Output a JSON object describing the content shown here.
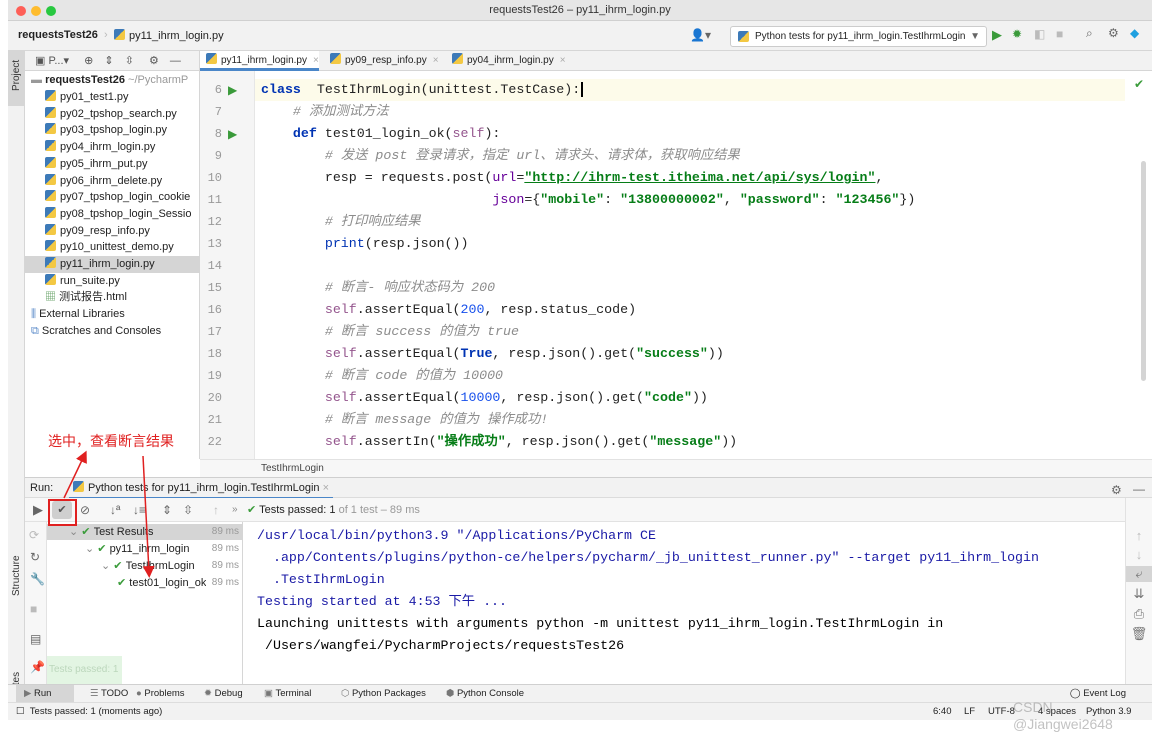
{
  "window": {
    "title": "requestsTest26 – py11_ihrm_login.py"
  },
  "nav": {
    "project": "requestsTest26",
    "file": "py11_ihrm_login.py",
    "run_config": "Python tests for py11_ihrm_login.TestIhrmLogin"
  },
  "sidebar": {
    "project_label": "Project",
    "structure_label": "Structure",
    "favorites_label": "Favorites",
    "panel_dropdown": "P...",
    "root": {
      "name": "requestsTest26",
      "path": "~/PycharmP"
    },
    "files": [
      "py01_test1.py",
      "py02_tpshop_search.py",
      "py03_tpshop_login.py",
      "py04_ihrm_login.py",
      "py05_ihrm_put.py",
      "py06_ihrm_delete.py",
      "py07_tpshop_login_cookie",
      "py08_tpshop_login_Sessio",
      "py09_resp_info.py",
      "py10_unittest_demo.py",
      "py11_ihrm_login.py",
      "run_suite.py",
      "测试报告.html"
    ],
    "selected_file": "py11_ihrm_login.py",
    "extras": [
      "External Libraries",
      "Scratches and Consoles"
    ]
  },
  "editor": {
    "tabs": [
      "py11_ihrm_login.py",
      "py09_resp_info.py",
      "py04_ihrm_login.py"
    ],
    "active_tab": 0,
    "lines": [
      {
        "n": "6",
        "run": true,
        "t": [
          [
            "kw",
            "class"
          ],
          [
            "",
            "  TestIhrmLogin(unittest.TestCase):"
          ]
        ]
      },
      {
        "n": "7",
        "t": [
          [
            "",
            "    "
          ],
          [
            "cm",
            "# 添加测试方法"
          ]
        ]
      },
      {
        "n": "8",
        "run": true,
        "t": [
          [
            "",
            "    "
          ],
          [
            "kw",
            "def"
          ],
          [
            "",
            " test01_login_ok("
          ],
          [
            "sf",
            "self"
          ],
          [
            "",
            "):"
          ]
        ]
      },
      {
        "n": "9",
        "t": [
          [
            "",
            "        "
          ],
          [
            "cm",
            "# 发送 post 登录请求，指定 url、请求头、请求体，获取响应结果"
          ]
        ]
      },
      {
        "n": "10",
        "t": [
          [
            "",
            "        resp = requests.post("
          ],
          [
            "pa",
            "url"
          ],
          [
            "",
            "="
          ],
          [
            "url",
            "\"http://ihrm-test.itheima.net/api/sys/login\""
          ],
          [
            "",
            ","
          ]
        ]
      },
      {
        "n": "11",
        "t": [
          [
            "",
            "                             "
          ],
          [
            "pa",
            "json"
          ],
          [
            "",
            "={"
          ],
          [
            "st",
            "\"mobile\""
          ],
          [
            "",
            ": "
          ],
          [
            "st",
            "\"13800000002\""
          ],
          [
            "",
            ", "
          ],
          [
            "st",
            "\"password\""
          ],
          [
            "",
            ": "
          ],
          [
            "st",
            "\"123456\""
          ],
          [
            "",
            "})"
          ]
        ]
      },
      {
        "n": "12",
        "t": [
          [
            "",
            "        "
          ],
          [
            "cm",
            "# 打印响应结果"
          ]
        ]
      },
      {
        "n": "13",
        "t": [
          [
            "",
            "        "
          ],
          [
            "bi",
            "print"
          ],
          [
            "",
            "(resp.json())"
          ]
        ]
      },
      {
        "n": "14",
        "t": []
      },
      {
        "n": "15",
        "t": [
          [
            "",
            "        "
          ],
          [
            "cm",
            "# 断言- 响应状态码为 200"
          ]
        ]
      },
      {
        "n": "16",
        "t": [
          [
            "",
            "        "
          ],
          [
            "sf",
            "self"
          ],
          [
            "",
            ".assertEqual("
          ],
          [
            "nm",
            "200"
          ],
          [
            "",
            ", resp.status_code)"
          ]
        ]
      },
      {
        "n": "17",
        "t": [
          [
            "",
            "        "
          ],
          [
            "cm",
            "# 断言 success 的值为 true"
          ]
        ]
      },
      {
        "n": "18",
        "t": [
          [
            "",
            "        "
          ],
          [
            "sf",
            "self"
          ],
          [
            "",
            ".assertEqual("
          ],
          [
            "kw",
            "True"
          ],
          [
            "",
            ", resp.json().get("
          ],
          [
            "st",
            "\"success\""
          ],
          [
            "",
            "))"
          ]
        ]
      },
      {
        "n": "19",
        "t": [
          [
            "",
            "        "
          ],
          [
            "cm",
            "# 断言 code 的值为 10000"
          ]
        ]
      },
      {
        "n": "20",
        "t": [
          [
            "",
            "        "
          ],
          [
            "sf",
            "self"
          ],
          [
            "",
            ".assertEqual("
          ],
          [
            "nm",
            "10000"
          ],
          [
            "",
            ", resp.json().get("
          ],
          [
            "st",
            "\"code\""
          ],
          [
            "",
            "))"
          ]
        ]
      },
      {
        "n": "21",
        "t": [
          [
            "",
            "        "
          ],
          [
            "cm",
            "# 断言 message 的值为 操作成功!"
          ]
        ]
      },
      {
        "n": "22",
        "t": [
          [
            "",
            "        "
          ],
          [
            "sf",
            "self"
          ],
          [
            "",
            ".assertIn("
          ],
          [
            "st",
            "\"操作成功\""
          ],
          [
            "",
            ", resp.json().get("
          ],
          [
            "st",
            "\"message\""
          ],
          [
            "",
            "))"
          ]
        ]
      }
    ],
    "breadcrumb": "TestIhrmLogin"
  },
  "run": {
    "label": "Run:",
    "tab": "Python tests for py11_ihrm_login.TestIhrmLogin",
    "status_bold": "Tests passed: 1",
    "status_rest": " of 1 test – 89 ms",
    "tree": [
      {
        "label": "Test Results",
        "ms": "89 ms"
      },
      {
        "label": "py11_ihrm_login",
        "ms": "89 ms"
      },
      {
        "label": "TestIhrmLogin",
        "ms": "89 ms"
      },
      {
        "label": "test01_login_ok",
        "ms": "89 ms"
      }
    ],
    "console": [
      "/usr/local/bin/python3.9 \"/Applications/PyCharm CE",
      "  .app/Contents/plugins/python-ce/helpers/pycharm/_jb_unittest_runner.py\" --target py11_ihrm_login",
      "  .TestIhrmLogin",
      "Testing started at 4:53 下午 ...",
      "Launching unittests with arguments python -m unittest py11_ihrm_login.TestIhrmLogin in",
      " /Users/wangfei/PycharmProjects/requestsTest26"
    ],
    "toast": "Tests passed: 1"
  },
  "annotation": {
    "text": "选中，查看断言结果",
    "color": "#e02020"
  },
  "bottom_tabs": [
    "Run",
    "TODO",
    "Problems",
    "Debug",
    "Terminal",
    "Python Packages",
    "Python Console"
  ],
  "event_log": "Event Log",
  "status": {
    "message": "Tests passed: 1 (moments ago)",
    "position": "6:40",
    "line_sep": "LF",
    "encoding": "UTF-8",
    "indent": "4 spaces",
    "interpreter": "Python 3.9"
  },
  "watermark": "CSDN @Jiangwei2648"
}
